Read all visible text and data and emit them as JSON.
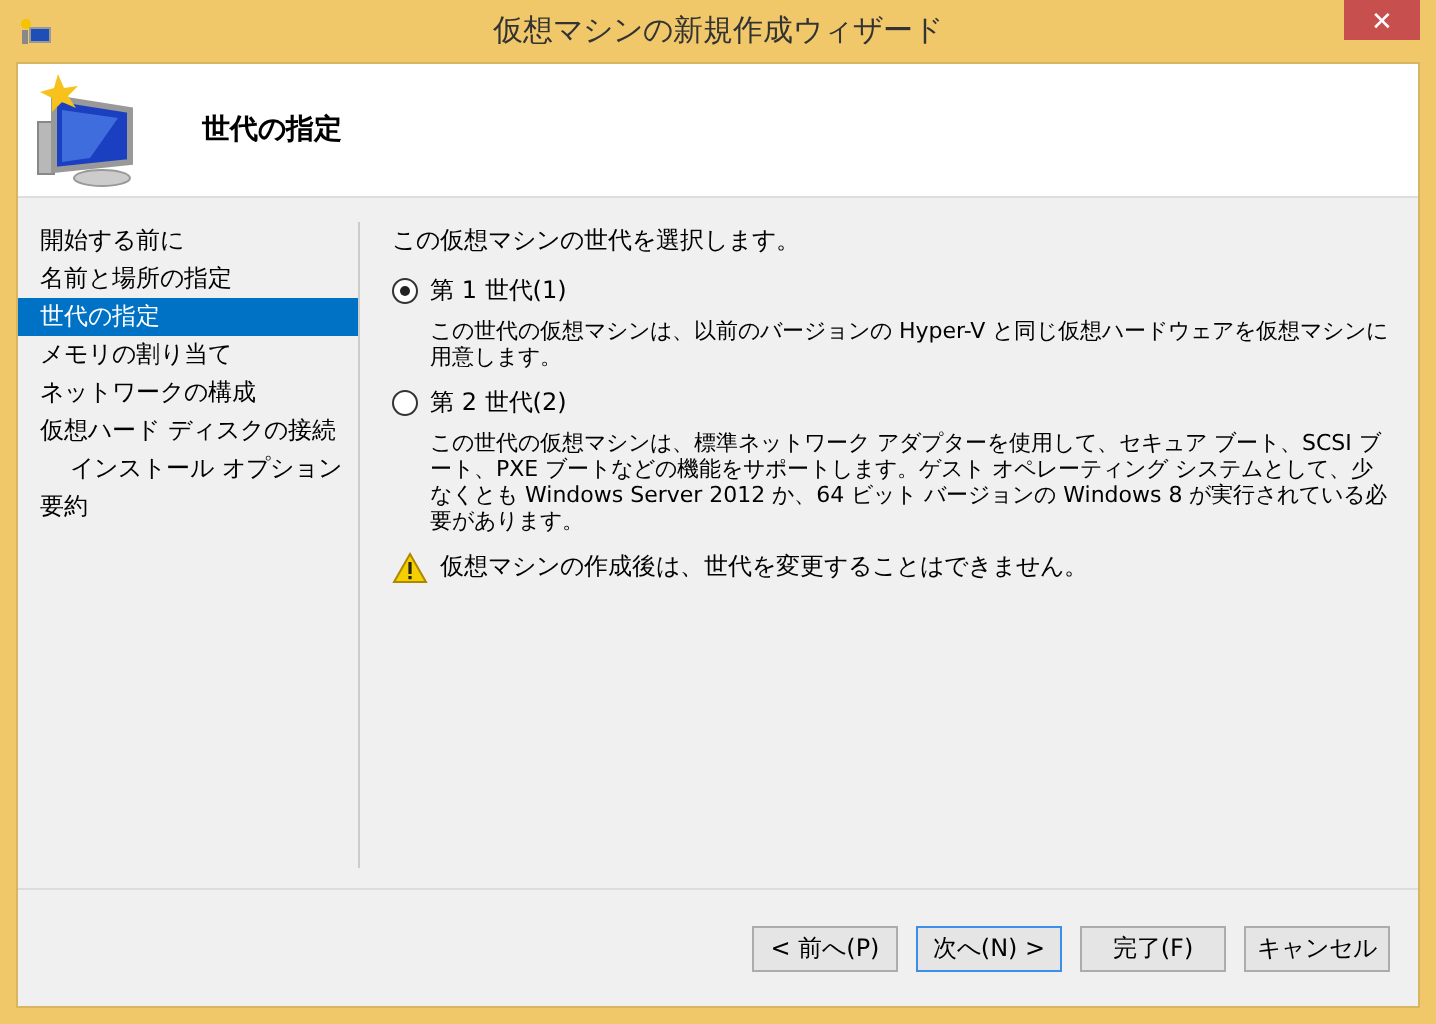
{
  "window": {
    "title": "仮想マシンの新規作成ウィザード",
    "close": "✕"
  },
  "header": {
    "title": "世代の指定"
  },
  "sidebar": {
    "items": [
      {
        "label": "開始する前に",
        "selected": false
      },
      {
        "label": "名前と場所の指定",
        "selected": false
      },
      {
        "label": "世代の指定",
        "selected": true
      },
      {
        "label": "メモリの割り当て",
        "selected": false
      },
      {
        "label": "ネットワークの構成",
        "selected": false
      },
      {
        "label": "仮想ハード ディスクの接続",
        "selected": false,
        "children": [
          {
            "label": "インストール オプション",
            "selected": false
          }
        ]
      },
      {
        "label": "要約",
        "selected": false
      }
    ]
  },
  "content": {
    "intro": "この仮想マシンの世代を選択します。",
    "options": [
      {
        "label": "第 1 世代(1)",
        "selected": true,
        "description": "この世代の仮想マシンは、以前のバージョンの Hyper-V と同じ仮想ハードウェアを仮想マシンに用意します。"
      },
      {
        "label": "第 2 世代(2)",
        "selected": false,
        "description": "この世代の仮想マシンは、標準ネットワーク アダプターを使用して、セキュア ブート、SCSI ブート、PXE ブートなどの機能をサポートします。ゲスト オペレーティング システムとして、少なくとも Windows Server 2012 か、64 ビット バージョンの Windows 8 が実行されている必要があります。"
      }
    ],
    "warning": "仮想マシンの作成後は、世代を変更することはできません。"
  },
  "buttons": [
    {
      "label": "< 前へ(P)",
      "focused": false
    },
    {
      "label": "次へ(N) >",
      "focused": true
    },
    {
      "label": "完了(F)",
      "focused": false
    },
    {
      "label": "キャンセル",
      "focused": false
    }
  ]
}
